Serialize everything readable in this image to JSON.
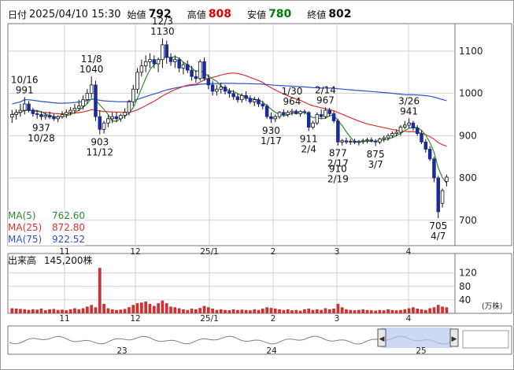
{
  "header": {
    "date_label": "日付",
    "datetime": "2025/04/10 15:30",
    "open_label": "始値",
    "open": "792",
    "high_label": "高値",
    "high": "808",
    "low_label": "安値",
    "low": "780",
    "close_label": "終値",
    "close": "802"
  },
  "colors": {
    "high": "#e00000",
    "low": "#008000",
    "up": "#ffffff",
    "down": "#1a2a9a",
    "ma5": "#2e8b2e",
    "ma25": "#e03030",
    "ma75": "#3050d0",
    "volume": "#d03030",
    "grid": "#c8c8c8",
    "navigator_fill": "#b8c8f0"
  },
  "ma_legend": [
    {
      "label": "MA(5)",
      "value": "762.60",
      "color": "#2e8b2e"
    },
    {
      "label": "MA(25)",
      "value": "872.80",
      "color": "#e03030"
    },
    {
      "label": "MA(75)",
      "value": "922.52",
      "color": "#3050d0"
    }
  ],
  "volume_legend": {
    "label": "出来高",
    "value": "145,200株"
  },
  "chart_data": [
    {
      "type": "candlestick",
      "title": "",
      "x_tick_labels": [
        "11",
        "12",
        "25/1",
        "2",
        "3",
        "4"
      ],
      "y_ticks": [
        700,
        800,
        900,
        1000,
        1100
      ],
      "ylim": [
        640,
        1165
      ],
      "grid": true,
      "candles": [
        [
          944,
          961,
          930,
          950
        ],
        [
          950,
          962,
          938,
          955
        ],
        [
          955,
          975,
          945,
          960
        ],
        [
          960,
          991,
          950,
          975
        ],
        [
          975,
          982,
          955,
          960
        ],
        [
          960,
          966,
          945,
          952
        ],
        [
          952,
          960,
          940,
          950
        ],
        [
          950,
          958,
          937,
          945
        ],
        [
          945,
          955,
          938,
          948
        ],
        [
          948,
          957,
          939,
          944
        ],
        [
          944,
          952,
          935,
          940
        ],
        [
          940,
          948,
          932,
          945
        ],
        [
          945,
          958,
          940,
          950
        ],
        [
          950,
          962,
          942,
          955
        ],
        [
          955,
          968,
          948,
          960
        ],
        [
          960,
          975,
          952,
          965
        ],
        [
          965,
          985,
          958,
          970
        ],
        [
          970,
          995,
          962,
          985
        ],
        [
          985,
          1010,
          975,
          1000
        ],
        [
          1000,
          1040,
          990,
          1020
        ],
        [
          1020,
          1030,
          935,
          945
        ],
        [
          945,
          960,
          903,
          915
        ],
        [
          915,
          935,
          905,
          930
        ],
        [
          930,
          948,
          920,
          940
        ],
        [
          940,
          955,
          930,
          945
        ],
        [
          945,
          955,
          932,
          940
        ],
        [
          940,
          952,
          933,
          948
        ],
        [
          948,
          965,
          940,
          955
        ],
        [
          955,
          985,
          948,
          980
        ],
        [
          980,
          1020,
          970,
          1010
        ],
        [
          1010,
          1060,
          1000,
          1050
        ],
        [
          1050,
          1080,
          1040,
          1065
        ],
        [
          1065,
          1090,
          1050,
          1075
        ],
        [
          1075,
          1095,
          1060,
          1080
        ],
        [
          1080,
          1090,
          1060,
          1070
        ],
        [
          1070,
          1085,
          1050,
          1080
        ],
        [
          1080,
          1130,
          1060,
          1115
        ],
        [
          1115,
          1125,
          1070,
          1085
        ],
        [
          1085,
          1095,
          1065,
          1075
        ],
        [
          1075,
          1090,
          1060,
          1080
        ],
        [
          1080,
          1085,
          1050,
          1060
        ],
        [
          1060,
          1075,
          1045,
          1068
        ],
        [
          1068,
          1078,
          1048,
          1055
        ],
        [
          1055,
          1065,
          1030,
          1040
        ],
        [
          1040,
          1055,
          1025,
          1035
        ],
        [
          1035,
          1080,
          1030,
          1075
        ],
        [
          1075,
          1085,
          1030,
          1035
        ],
        [
          1035,
          1045,
          1010,
          1020
        ],
        [
          1020,
          1030,
          995,
          1005
        ],
        [
          1005,
          1020,
          995,
          1010
        ],
        [
          1010,
          1025,
          1000,
          1015
        ],
        [
          1015,
          1020,
          998,
          1005
        ],
        [
          1005,
          1012,
          990,
          1000
        ],
        [
          1000,
          1008,
          985,
          992
        ],
        [
          992,
          1000,
          978,
          985
        ],
        [
          985,
          1000,
          978,
          995
        ],
        [
          995,
          1005,
          982,
          988
        ],
        [
          988,
          995,
          975,
          980
        ],
        [
          980,
          992,
          970,
          985
        ],
        [
          985,
          990,
          968,
          975
        ],
        [
          975,
          982,
          962,
          970
        ],
        [
          970,
          975,
          940,
          945
        ],
        [
          945,
          955,
          930,
          940
        ],
        [
          940,
          950,
          932,
          945
        ],
        [
          945,
          958,
          940,
          955
        ],
        [
          955,
          962,
          945,
          950
        ],
        [
          950,
          960,
          944,
          955
        ],
        [
          955,
          964,
          948,
          958
        ],
        [
          958,
          962,
          950,
          952
        ],
        [
          952,
          960,
          945,
          957
        ],
        [
          957,
          962,
          950,
          955
        ],
        [
          955,
          958,
          911,
          920
        ],
        [
          920,
          935,
          915,
          930
        ],
        [
          930,
          955,
          925,
          950
        ],
        [
          950,
          962,
          940,
          945
        ],
        [
          945,
          967,
          940,
          960
        ],
        [
          960,
          966,
          945,
          952
        ],
        [
          952,
          958,
          930,
          935
        ],
        [
          935,
          940,
          877,
          885
        ],
        [
          885,
          892,
          877,
          888
        ],
        [
          888,
          895,
          880,
          885
        ],
        [
          885,
          892,
          878,
          887
        ],
        [
          887,
          893,
          880,
          884
        ],
        [
          884,
          890,
          877,
          886
        ],
        [
          886,
          893,
          880,
          888
        ],
        [
          888,
          895,
          882,
          890
        ],
        [
          890,
          896,
          884,
          887
        ],
        [
          887,
          892,
          875,
          885
        ],
        [
          885,
          895,
          880,
          892
        ],
        [
          892,
          900,
          885,
          895
        ],
        [
          895,
          905,
          888,
          900
        ],
        [
          900,
          910,
          895,
          905
        ],
        [
          905,
          915,
          898,
          908
        ],
        [
          908,
          925,
          900,
          920
        ],
        [
          920,
          935,
          915,
          925
        ],
        [
          925,
          941,
          918,
          930
        ],
        [
          930,
          935,
          912,
          918
        ],
        [
          918,
          925,
          900,
          905
        ],
        [
          905,
          912,
          880,
          885
        ],
        [
          885,
          892,
          860,
          868
        ],
        [
          868,
          875,
          840,
          845
        ],
        [
          845,
          850,
          790,
          800
        ],
        [
          800,
          805,
          705,
          720
        ],
        [
          740,
          775,
          730,
          770
        ],
        [
          792,
          808,
          780,
          802
        ]
      ],
      "ma5_last": 762.6,
      "ma25_last": 872.8,
      "ma75_last": 922.52,
      "annotations": [
        {
          "text": "10/16",
          "value": "991",
          "kind": "high",
          "candle": 3
        },
        {
          "text": "10/28",
          "value": "937",
          "kind": "low",
          "candle": 7
        },
        {
          "text": "11/8",
          "value": "1040",
          "kind": "high",
          "candle": 19
        },
        {
          "text": "11/12",
          "value": "903",
          "kind": "low",
          "candle": 21
        },
        {
          "text": "12/3",
          "value": "1130",
          "kind": "high",
          "candle": 36
        },
        {
          "text": "1/17",
          "value": "930",
          "kind": "low",
          "candle": 62
        },
        {
          "text": "1/30",
          "value": "964",
          "kind": "high",
          "candle": 67
        },
        {
          "text": "2/4",
          "value": "911",
          "kind": "low",
          "candle": 71
        },
        {
          "text": "2/14",
          "value": "967",
          "kind": "high",
          "candle": 75
        },
        {
          "text": "2/17",
          "value": "877",
          "kind": "low",
          "candle": 78
        },
        {
          "text": "2/19",
          "value": "910",
          "kind": "low",
          "candle": 78
        },
        {
          "text": "3/7",
          "value": "875",
          "kind": "low",
          "candle": 87
        },
        {
          "text": "3/26",
          "value": "941",
          "kind": "high",
          "candle": 95
        },
        {
          "text": "4/7",
          "value": "705",
          "kind": "low",
          "candle": 102
        }
      ]
    },
    {
      "type": "bar",
      "title": "出来高",
      "ylabel": "万株",
      "y_ticks": [
        40,
        80,
        120
      ],
      "ylim": [
        0,
        145
      ],
      "values": [
        15,
        14,
        13,
        12,
        10,
        12,
        11,
        14,
        9,
        12,
        13,
        10,
        11,
        9,
        12,
        15,
        12,
        15,
        20,
        25,
        18,
        135,
        28,
        15,
        12,
        10,
        11,
        13,
        18,
        25,
        30,
        32,
        35,
        28,
        22,
        30,
        38,
        30,
        20,
        18,
        15,
        12,
        10,
        14,
        12,
        16,
        22,
        18,
        14,
        10,
        12,
        10,
        9,
        12,
        10,
        11,
        10,
        9,
        12,
        10,
        14,
        18,
        16,
        14,
        12,
        10,
        12,
        9,
        10,
        8,
        12,
        14,
        10,
        12,
        10,
        15,
        12,
        14,
        28,
        18,
        12,
        10,
        9,
        10,
        12,
        10,
        9,
        8,
        10,
        9,
        12,
        10,
        9,
        10,
        12,
        15,
        18,
        14,
        12,
        10,
        15,
        18,
        25,
        20,
        18
      ]
    },
    {
      "type": "area",
      "title": "",
      "x_tick_labels": [
        "23",
        "24",
        "25"
      ],
      "selected_range_label": ""
    }
  ]
}
